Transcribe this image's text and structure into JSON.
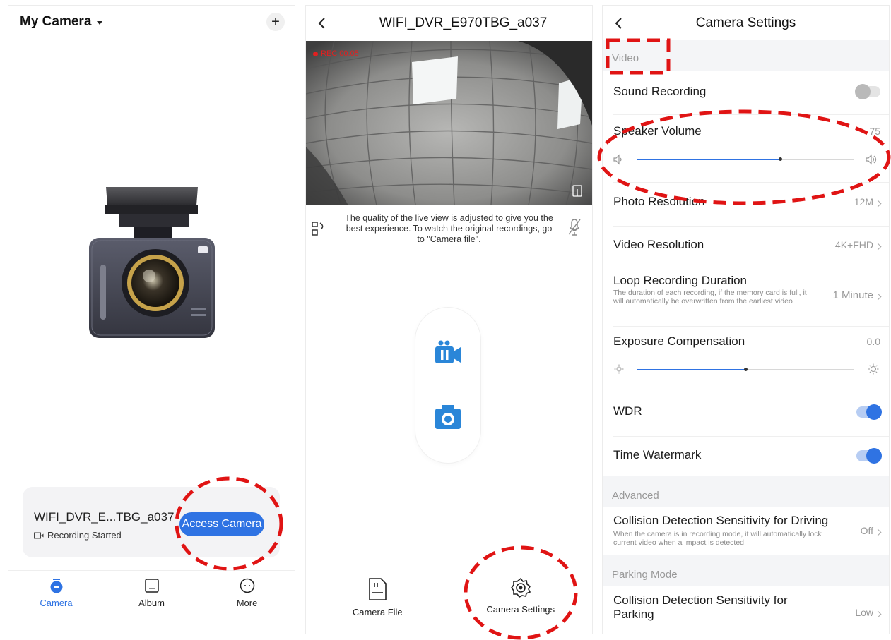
{
  "home": {
    "title": "My Camera",
    "add_icon": "plus-icon",
    "device": {
      "name": "WIFI_DVR_E...TBG_a037",
      "status": "Recording Started",
      "access_label": "Access Camera"
    },
    "tabs": [
      {
        "label": "Camera",
        "icon": "camera-tab-icon"
      },
      {
        "label": "Album",
        "icon": "album-icon"
      },
      {
        "label": "More",
        "icon": "more-icon"
      }
    ]
  },
  "live": {
    "title": "WIFI_DVR_E970TBG_a037",
    "rec_text": "REC 00:05",
    "quality_note": "The quality of the live view is adjusted to give you the best experience. To watch the original recordings, go to \"Camera file\".",
    "bottom": [
      {
        "label": "Camera File",
        "icon": "sd-card-icon"
      },
      {
        "label": "Camera Settings",
        "icon": "gear-icon"
      }
    ]
  },
  "settings": {
    "title": "Camera Settings",
    "sections": {
      "video": "Video",
      "advanced": "Advanced",
      "parking": "Parking Mode"
    },
    "sound_recording": {
      "label": "Sound Recording",
      "on": false
    },
    "speaker_volume": {
      "label": "Speaker Volume",
      "value": "75",
      "level": 0.66
    },
    "photo_resolution": {
      "label": "Photo Resolution",
      "value": "12M"
    },
    "video_resolution": {
      "label": "Video Resolution",
      "value": "4K+FHD"
    },
    "loop_recording": {
      "label": "Loop Recording Duration",
      "sub": "The duration of each recording, if the memory card is full, it will automatically be overwritten from the earliest video",
      "value": "1 Minute"
    },
    "exposure": {
      "label": "Exposure Compensation",
      "value": "0.0",
      "level": 0.5
    },
    "wdr": {
      "label": "WDR",
      "on": true
    },
    "time_watermark": {
      "label": "Time Watermark",
      "on": true
    },
    "collision_driving": {
      "label": "Collision Detection Sensitivity for Driving",
      "sub": "When the camera is in recording mode, it will automatically lock current video when a impact is detected",
      "value": "Off"
    },
    "collision_parking": {
      "label_line1": "Collision Detection Sensitivity for",
      "label_line2": "Parking",
      "value": "Low"
    }
  },
  "colors": {
    "accent": "#2f73e3",
    "annotation": "#e01414"
  }
}
